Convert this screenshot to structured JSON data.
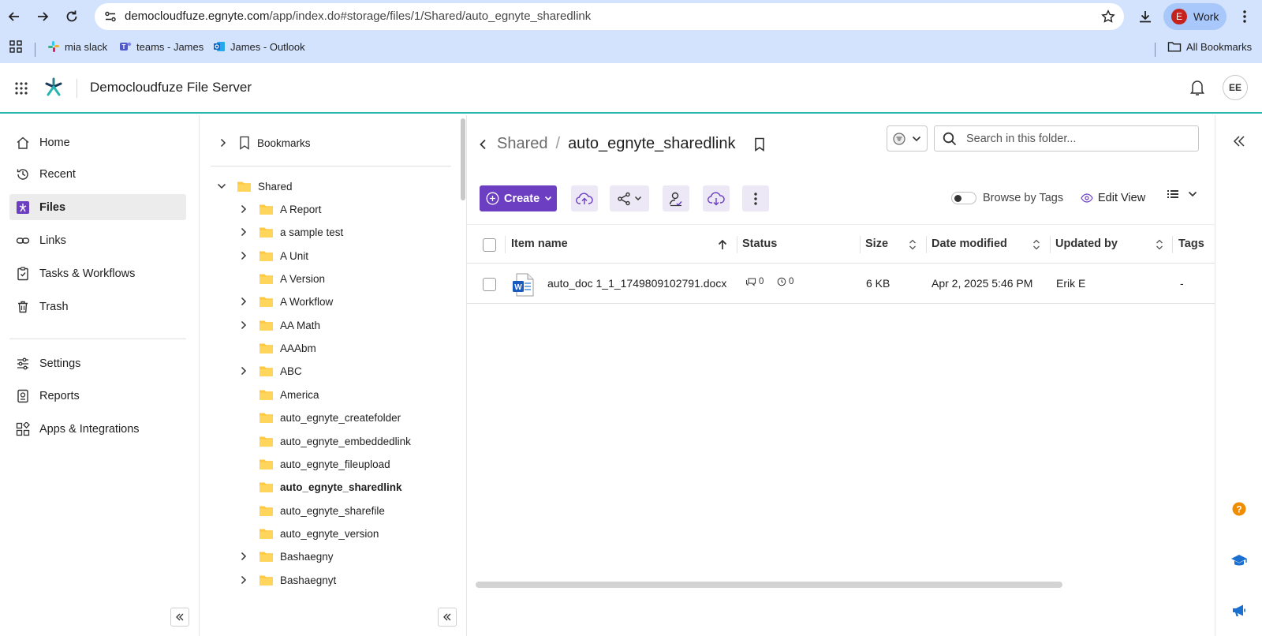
{
  "browser": {
    "url_host": "democloudfuze.egnyte.com",
    "url_path": "/app/index.do#storage/files/1/Shared/auto_egnyte_sharedlink",
    "profile_initial": "E",
    "profile_label": "Work",
    "bookmarks": [
      {
        "label": "mia slack",
        "icon": "slack-icon"
      },
      {
        "label": "teams - James",
        "icon": "teams-icon"
      },
      {
        "label": "James - Outlook",
        "icon": "outlook-icon"
      }
    ],
    "all_bookmarks": "All Bookmarks"
  },
  "app": {
    "title": "Democloudfuze File Server",
    "avatar": "EE",
    "accent": "#6c3ec2",
    "header_border": "#26b5b0"
  },
  "nav": {
    "items": [
      {
        "label": "Home",
        "icon": "home-icon"
      },
      {
        "label": "Recent",
        "icon": "clock-icon"
      },
      {
        "label": "Files",
        "icon": "files-icon",
        "active": true
      },
      {
        "label": "Links",
        "icon": "link-icon"
      },
      {
        "label": "Tasks & Workflows",
        "icon": "clipboard-icon"
      },
      {
        "label": "Trash",
        "icon": "trash-icon"
      }
    ],
    "secondary": [
      {
        "label": "Settings",
        "icon": "sliders-icon"
      },
      {
        "label": "Reports",
        "icon": "report-icon"
      },
      {
        "label": "Apps & Integrations",
        "icon": "apps-icon"
      }
    ]
  },
  "tree": {
    "bookmarks": "Bookmarks",
    "root": "Shared",
    "folders": [
      {
        "name": "A Report",
        "expandable": true
      },
      {
        "name": "a sample test",
        "expandable": true
      },
      {
        "name": "A Unit",
        "expandable": true
      },
      {
        "name": "A Version",
        "expandable": false
      },
      {
        "name": "A Workflow",
        "expandable": true
      },
      {
        "name": "AA Math",
        "expandable": true
      },
      {
        "name": "AAAbm",
        "expandable": false
      },
      {
        "name": "ABC",
        "expandable": true
      },
      {
        "name": "America",
        "expandable": false
      },
      {
        "name": "auto_egnyte_createfolder",
        "expandable": false
      },
      {
        "name": "auto_egnyte_embeddedlink",
        "expandable": false
      },
      {
        "name": "auto_egnyte_fileupload",
        "expandable": false
      },
      {
        "name": "auto_egnyte_sharedlink",
        "expandable": false,
        "selected": true
      },
      {
        "name": "auto_egnyte_sharefile",
        "expandable": false
      },
      {
        "name": "auto_egnyte_version",
        "expandable": false
      },
      {
        "name": "Bashaegny",
        "expandable": true
      },
      {
        "name": "Bashaegnyt",
        "expandable": true
      }
    ]
  },
  "main": {
    "breadcrumb": {
      "parent": "Shared",
      "separator": "/",
      "current": "auto_egnyte_sharedlink"
    },
    "search_placeholder": "Search in this folder...",
    "create_label": "Create",
    "browse_by_tags": "Browse by Tags",
    "edit_view": "Edit View",
    "columns": {
      "name": "Item name",
      "status": "Status",
      "size": "Size",
      "date": "Date modified",
      "updated_by": "Updated by",
      "tags": "Tags"
    },
    "rows": [
      {
        "name": "auto_doc 1_1_1749809102791.docx",
        "comments": "0",
        "versions": "0",
        "size": "6 KB",
        "date": "Apr 2, 2025 5:46 PM",
        "updated_by": "Erik E",
        "tags": "-"
      }
    ]
  }
}
